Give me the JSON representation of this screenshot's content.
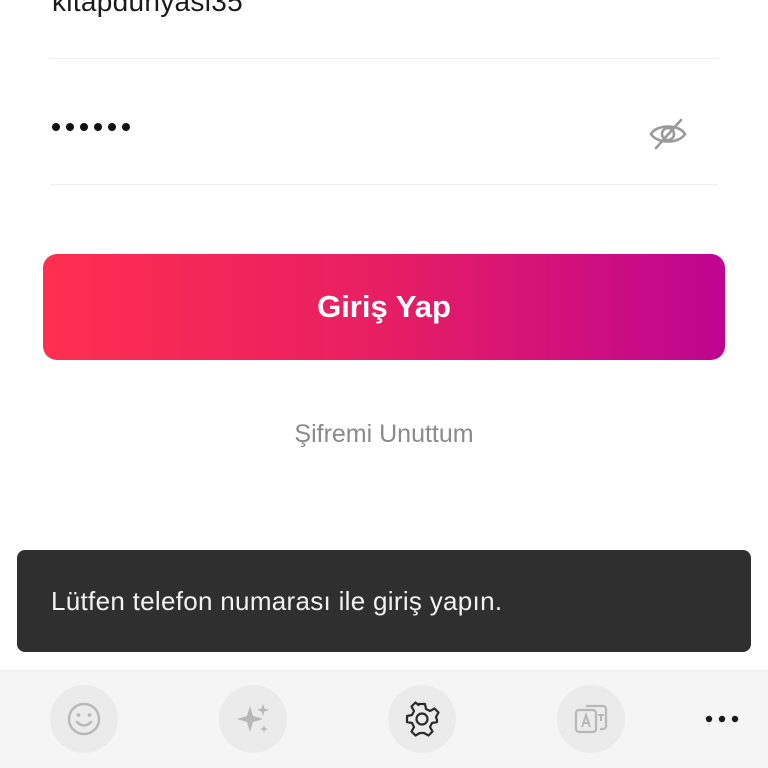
{
  "login_form": {
    "username_value": "kitapdunyasi35",
    "password_mask": "••••••",
    "password_length": 6,
    "show_password_icon": "eye-off-icon"
  },
  "login_button": {
    "label": "Giriş Yap"
  },
  "forgot_password": {
    "label": "Şifremi Unuttum"
  },
  "toast": {
    "message": "Lütfen telefon numarası ile giriş yapın."
  },
  "keyboard_toolbar": {
    "buttons": [
      {
        "icon": "emoji-icon"
      },
      {
        "icon": "sparkles-icon"
      },
      {
        "icon": "gear-icon"
      },
      {
        "icon": "translate-icon"
      },
      {
        "icon": "more-icon"
      }
    ]
  },
  "colors": {
    "gradient_start": "#fe2f4f",
    "gradient_end": "#be0591",
    "toast_background": "#2f2f2f",
    "link_gray": "#8a8a8a"
  }
}
